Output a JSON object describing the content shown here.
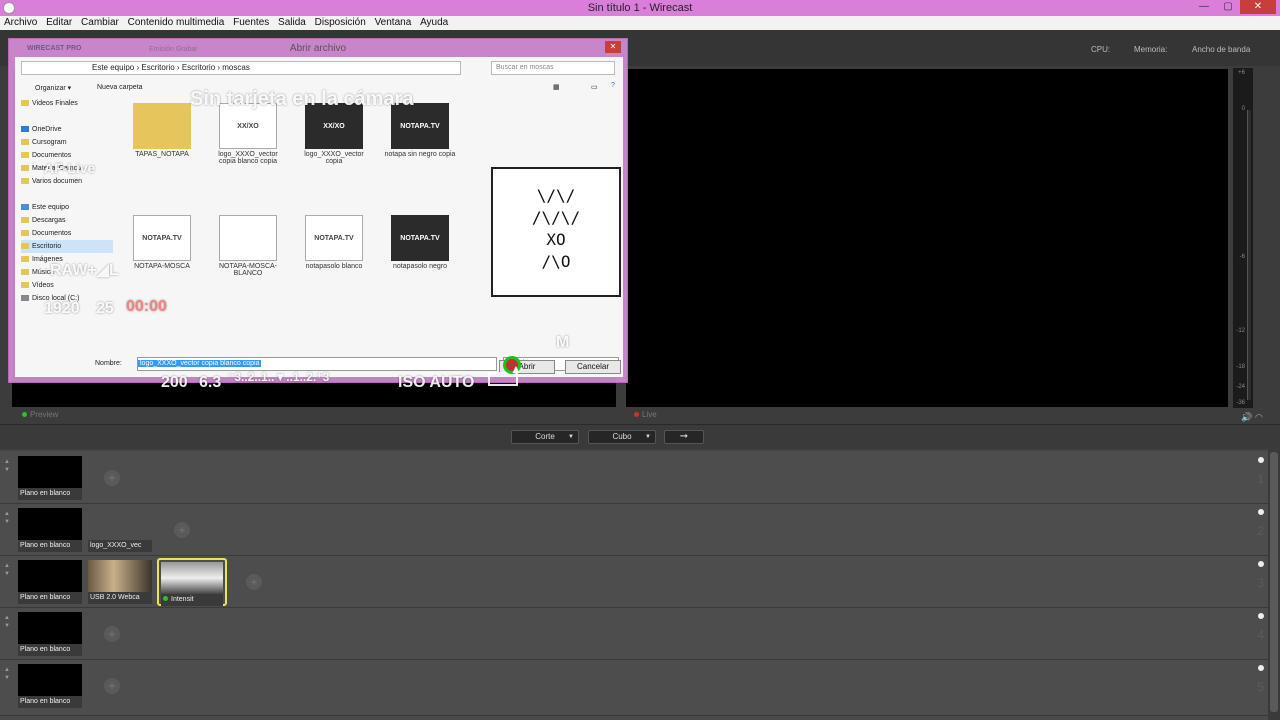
{
  "window": {
    "title": "Sin título 1 - Wirecast",
    "controls": {
      "minimize": "—",
      "maximize": "▢",
      "close": "✕"
    }
  },
  "menu": [
    "Archivo",
    "Editar",
    "Cambiar",
    "Contenido multimedia",
    "Fuentes",
    "Salida",
    "Disposición",
    "Ventana",
    "Ayuda"
  ],
  "stats": {
    "cpu": "CPU:",
    "memory": "Memoria:",
    "bandwidth": "Ancho de banda"
  },
  "preview": {
    "label": "Preview"
  },
  "live": {
    "label": "Live"
  },
  "vu_scale": [
    "+6",
    "0",
    "-6",
    "-12",
    "-18",
    "-24",
    "-36"
  ],
  "transition": {
    "cut": "Corte",
    "cube": "Cubo",
    "go": "➞"
  },
  "layers": [
    {
      "num": "1",
      "shots": [
        {
          "caption": "Plano en blanco"
        }
      ]
    },
    {
      "num": "2",
      "shots": [
        {
          "caption": "Plano en blanco"
        },
        {
          "caption": "logo_XXXO_vec"
        }
      ]
    },
    {
      "num": "3",
      "shots": [
        {
          "caption": "Plano en blanco"
        },
        {
          "caption": "USB 2.0 Webca"
        },
        {
          "caption": "Intensit"
        }
      ]
    },
    {
      "num": "4",
      "shots": [
        {
          "caption": "Plano en blanco"
        }
      ]
    },
    {
      "num": "5",
      "shots": [
        {
          "caption": "Plano en blanco"
        }
      ]
    }
  ],
  "dialog": {
    "title": "Abrir archivo",
    "brand": "WIRECAST PRO",
    "ghost_tabs": "Emisión      Grabar",
    "path": "Este equipo  ›  Escritorio  ›  Escritorio  ›  moscas",
    "search_placeholder": "Buscar en moscas",
    "organize": "Organizar ▾",
    "new_folder": "Nueva carpeta",
    "tree": [
      "Videos Finales",
      "",
      "OneDrive",
      "Cursogram",
      "Documentos",
      "Material Camcu",
      "Varios documen",
      "",
      "Este equipo",
      "Descargas",
      "Documentos",
      "Escritorio",
      "Imágenes",
      "Música",
      "Vídeos",
      "Disco local (C:)"
    ],
    "files": [
      {
        "name": "TAPAS_NOTAPA",
        "icon": ""
      },
      {
        "name": "logo_XXXO_vector copia blanco copia",
        "icon": "XX/XO"
      },
      {
        "name": "logo_XXXO_vector copia",
        "icon": "XX/XO"
      },
      {
        "name": "notapa sin negro copia",
        "icon": "NOTAPA.TV"
      },
      {
        "name": "NOTAPA-MOSCA",
        "icon": "NOTAPA.TV"
      },
      {
        "name": "NOTAPA-MOSCA-BLANCO",
        "icon": ""
      },
      {
        "name": "notapasolo blanco",
        "icon": "NOTAPA.TV"
      },
      {
        "name": "notapasolo negro",
        "icon": "NOTAPA.TV"
      }
    ],
    "preview_art": "\\/\\/\n/\\/\\/\nXO\n/\\O",
    "name_label": "Nombre:",
    "name_value": "logo_XXXO_vector copia blanco copia",
    "type_value": "Ct... (",
    "open": "Abrir",
    "cancel": "Cancelar"
  },
  "camera_overlay": {
    "headline": "Sin tarjeta en la cámara",
    "af_mode": "AF-Live",
    "quality": "RAW+◢L",
    "resolution": "1920",
    "fps": "25",
    "timecode": "00:00",
    "shutter": "200",
    "aperture": "6.3",
    "exposure_scale": "⁻3..2..1..▼..1..2.⁺3",
    "iso": "ISO AUTO",
    "mode": "M"
  }
}
